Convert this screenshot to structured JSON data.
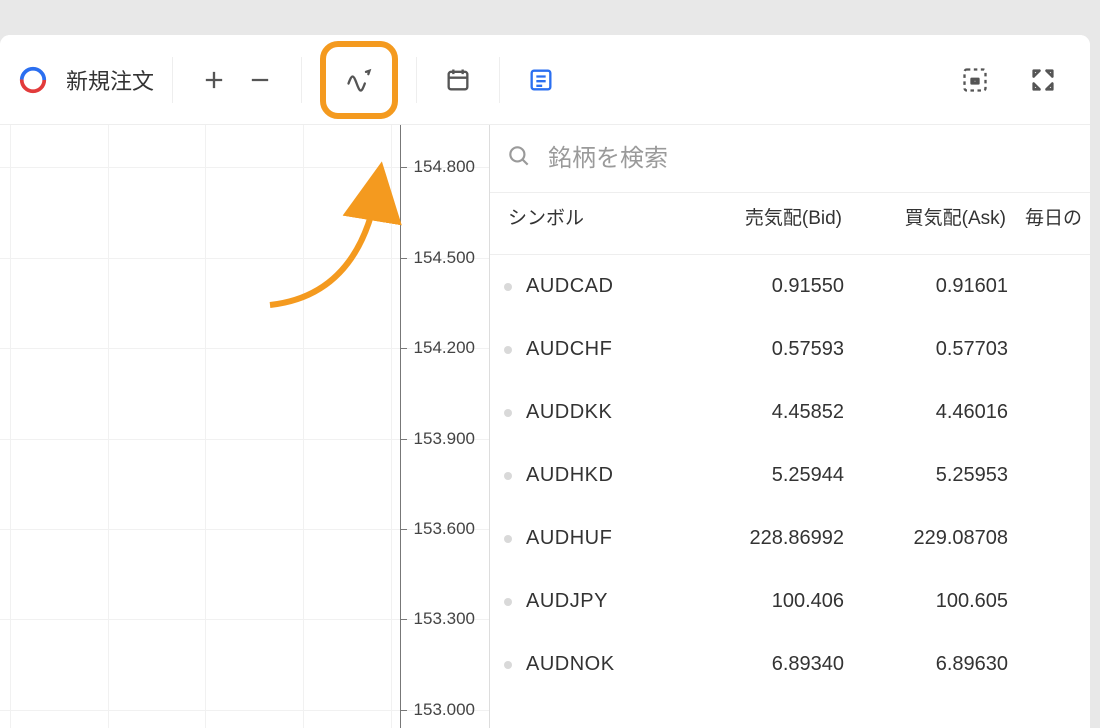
{
  "toolbar": {
    "title": "新規注文"
  },
  "search": {
    "placeholder": "銘柄を検索"
  },
  "columns": {
    "symbol": "シンボル",
    "bid": "売気配(Bid)",
    "ask": "買気配(Ask)",
    "daily": "毎日の"
  },
  "chart": {
    "ticks": [
      {
        "label": "154.800",
        "y_pct": 7
      },
      {
        "label": "154.500",
        "y_pct": 22
      },
      {
        "label": "154.200",
        "y_pct": 37
      },
      {
        "label": "153.900",
        "y_pct": 52
      },
      {
        "label": "153.600",
        "y_pct": 67
      },
      {
        "label": "153.300",
        "y_pct": 82
      },
      {
        "label": "153.000",
        "y_pct": 97
      }
    ],
    "vlines_pct": [
      2,
      22,
      42,
      62,
      80
    ]
  },
  "rows": [
    {
      "symbol": "AUDCAD",
      "bid": "0.91550",
      "ask": "0.91601"
    },
    {
      "symbol": "AUDCHF",
      "bid": "0.57593",
      "ask": "0.57703"
    },
    {
      "symbol": "AUDDKK",
      "bid": "4.45852",
      "ask": "4.46016"
    },
    {
      "symbol": "AUDHKD",
      "bid": "5.25944",
      "ask": "5.25953"
    },
    {
      "symbol": "AUDHUF",
      "bid": "228.86992",
      "ask": "229.08708"
    },
    {
      "symbol": "AUDJPY",
      "bid": "100.406",
      "ask": "100.605"
    },
    {
      "symbol": "AUDNOK",
      "bid": "6.89340",
      "ask": "6.89630"
    }
  ]
}
